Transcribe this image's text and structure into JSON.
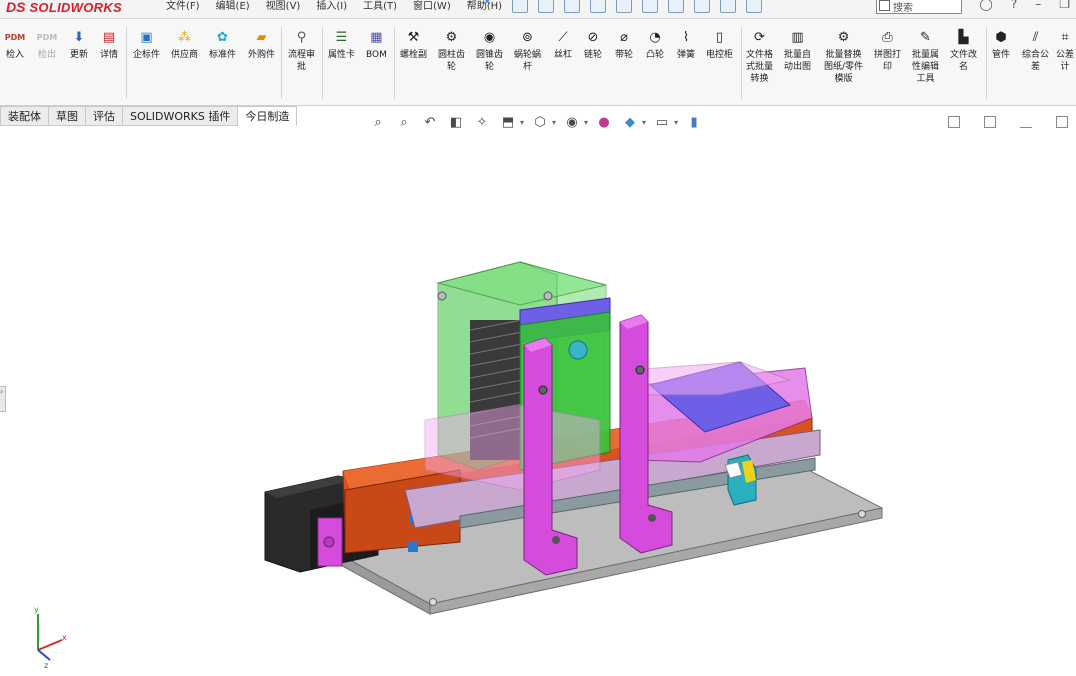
{
  "app": {
    "logo_mark": "DS",
    "logo_text": "SOLIDWORKS",
    "menu": [
      "文件(F)",
      "编辑(E)",
      "视图(V)",
      "插入(I)",
      "工具(T)",
      "窗口(W)",
      "帮助(H)"
    ],
    "search_placeholder": "搜索",
    "help_symbol": "?"
  },
  "ribbon": [
    {
      "label": "检入",
      "icon": "pdm-checkin-icon",
      "enabled": true
    },
    {
      "label": "检出",
      "icon": "pdm-checkout-icon",
      "enabled": false
    },
    {
      "label": "更新",
      "icon": "update-icon",
      "enabled": true
    },
    {
      "label": "详情",
      "icon": "details-icon",
      "enabled": true
    },
    {
      "label": "企标件",
      "icon": "enterprise-part-icon",
      "enabled": true
    },
    {
      "label": "供应商",
      "icon": "supplier-icon",
      "enabled": true
    },
    {
      "label": "标准件",
      "icon": "standard-part-icon",
      "enabled": true
    },
    {
      "label": "外购件",
      "icon": "purchased-part-icon",
      "enabled": true
    },
    {
      "label": "流程审\n批",
      "icon": "approval-flow-icon",
      "enabled": true
    },
    {
      "label": "属性卡",
      "icon": "property-card-icon",
      "enabled": true
    },
    {
      "label": "BOM",
      "icon": "bom-icon",
      "enabled": true
    },
    {
      "label": "螺栓副",
      "icon": "bolt-pair-icon",
      "enabled": true
    },
    {
      "label": "圆柱齿\n轮",
      "icon": "spur-gear-icon",
      "enabled": true
    },
    {
      "label": "圆锥齿\n轮",
      "icon": "bevel-gear-icon",
      "enabled": true
    },
    {
      "label": "蜗轮蜗\n杆",
      "icon": "worm-gear-icon",
      "enabled": true
    },
    {
      "label": "丝杠",
      "icon": "lead-screw-icon",
      "enabled": true
    },
    {
      "label": "链轮",
      "icon": "sprocket-icon",
      "enabled": true
    },
    {
      "label": "带轮",
      "icon": "pulley-icon",
      "enabled": true
    },
    {
      "label": "凸轮",
      "icon": "cam-icon",
      "enabled": true
    },
    {
      "label": "弹簧",
      "icon": "spring-icon",
      "enabled": true
    },
    {
      "label": "电控柜",
      "icon": "control-cabinet-icon",
      "enabled": true
    },
    {
      "label": "文件格\n式批量\n转换",
      "icon": "batch-convert-icon",
      "enabled": true
    },
    {
      "label": "批量自\n动出图",
      "icon": "batch-drawing-icon",
      "enabled": true
    },
    {
      "label": "批量替换\n图纸/零件\n模版",
      "icon": "batch-replace-template-icon",
      "enabled": true
    },
    {
      "label": "拼图打\n印",
      "icon": "print-icon",
      "enabled": true
    },
    {
      "label": "批量属\n性编辑\n工具",
      "icon": "batch-property-edit-icon",
      "enabled": true
    },
    {
      "label": "文件改\n名",
      "icon": "rename-file-icon",
      "enabled": true
    },
    {
      "label": "管件",
      "icon": "pipe-fitting-icon",
      "enabled": true
    },
    {
      "label": "综合公\n差",
      "icon": "tolerance-icon",
      "enabled": true
    },
    {
      "label": "公差\n计",
      "icon": "tolerance-calc-icon",
      "enabled": true
    }
  ],
  "tabs": [
    {
      "label": "装配体",
      "active": false
    },
    {
      "label": "草图",
      "active": false
    },
    {
      "label": "评估",
      "active": false
    },
    {
      "label": "SOLIDWORKS 插件",
      "active": false
    },
    {
      "label": "今日制造",
      "active": true
    }
  ],
  "colors": {
    "green_frame": "#39c23b",
    "magenta_parts": "#d54bdc",
    "orange_slide": "#d9531e",
    "motor": "#2b2b2b",
    "base_plate": "#b9b9b9",
    "blue_tray": "#6e60e6"
  }
}
